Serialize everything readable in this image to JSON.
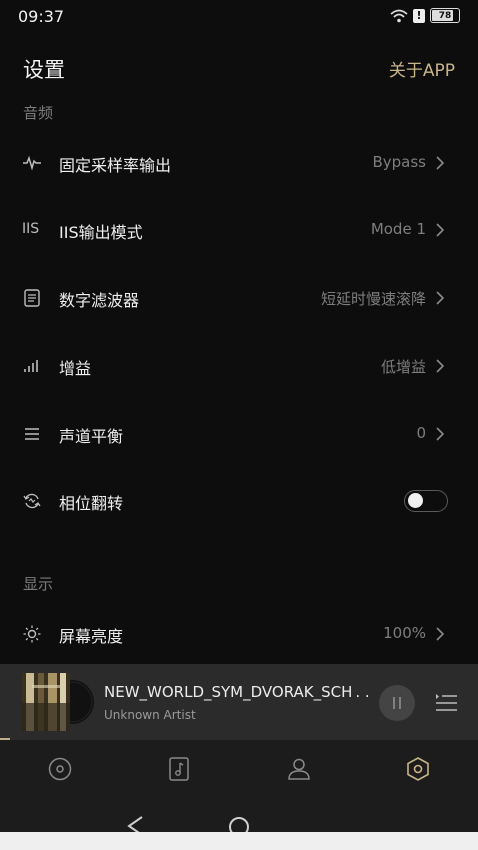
{
  "status_bar": {
    "time": "09:37",
    "battery": "78",
    "alert": "!"
  },
  "header": {
    "title": "设置",
    "about": "关于APP"
  },
  "sections": {
    "audio": "音频",
    "display": "显示"
  },
  "settings": [
    {
      "label": "固定采样率输出",
      "value": "Bypass",
      "icon": "waveform-icon"
    },
    {
      "label": "IIS输出模式",
      "value": "Mode 1",
      "icon": "iis-icon"
    },
    {
      "label": "数字滤波器",
      "value": "短延时慢速滚降",
      "icon": "filter-icon"
    },
    {
      "label": "增益",
      "value": "低增益",
      "icon": "signal-bars-icon"
    },
    {
      "label": "声道平衡",
      "value": "0",
      "icon": "menu-lines-icon"
    },
    {
      "label": "相位翻转",
      "toggle": false,
      "icon": "phase-rotate-icon"
    },
    {
      "label": "屏幕亮度",
      "value": "100%",
      "icon": "brightness-icon"
    }
  ],
  "iis_icon_text": "IIS",
  "player": {
    "title": "NEW_WORLD_SYM_DVORAK_SCH . .",
    "artist": "Unknown Artist",
    "state": "playing",
    "progress": 0.02
  },
  "tabs": [
    "disc-icon",
    "music-note-icon",
    "user-icon",
    "settings-hexagon-icon"
  ],
  "colors": {
    "accent": "#c9b58a",
    "background": "#0d0d0d",
    "player_bg": "#2b2b2b"
  }
}
